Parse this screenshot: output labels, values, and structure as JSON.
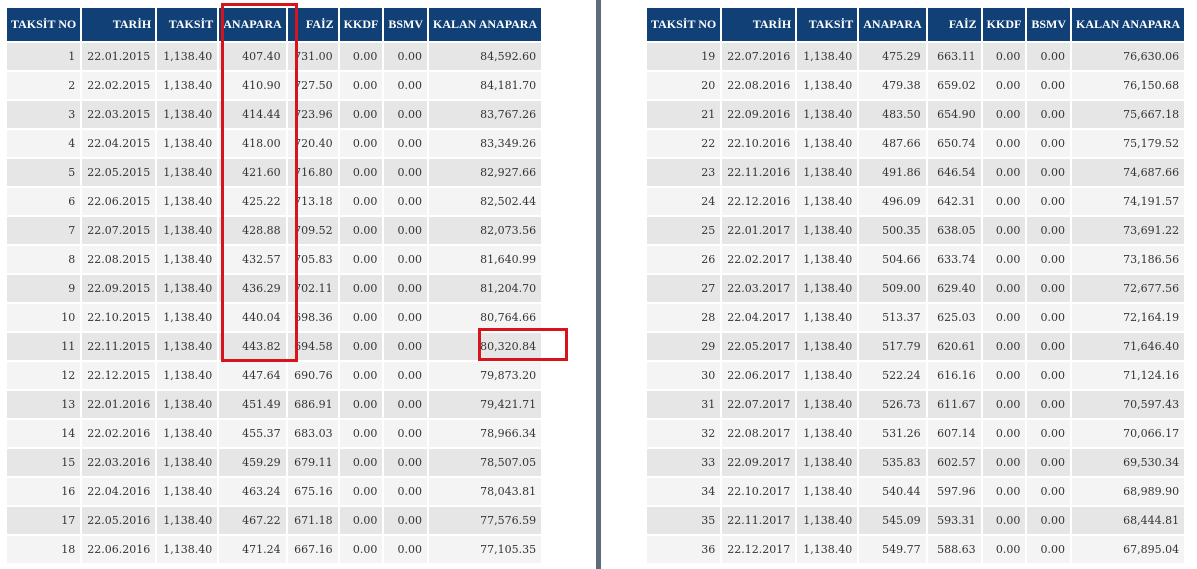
{
  "headers": [
    "TAKSİT NO",
    "TARİH",
    "TAKSİT",
    "ANAPARA",
    "FAİZ",
    "KKDF",
    "BSMV",
    "KALAN ANAPARA"
  ],
  "left_rows": [
    [
      "1",
      "22.01.2015",
      "1,138.40",
      "407.40",
      "731.00",
      "0.00",
      "0.00",
      "84,592.60"
    ],
    [
      "2",
      "22.02.2015",
      "1,138.40",
      "410.90",
      "727.50",
      "0.00",
      "0.00",
      "84,181.70"
    ],
    [
      "3",
      "22.03.2015",
      "1,138.40",
      "414.44",
      "723.96",
      "0.00",
      "0.00",
      "83,767.26"
    ],
    [
      "4",
      "22.04.2015",
      "1,138.40",
      "418.00",
      "720.40",
      "0.00",
      "0.00",
      "83,349.26"
    ],
    [
      "5",
      "22.05.2015",
      "1,138.40",
      "421.60",
      "716.80",
      "0.00",
      "0.00",
      "82,927.66"
    ],
    [
      "6",
      "22.06.2015",
      "1,138.40",
      "425.22",
      "713.18",
      "0.00",
      "0.00",
      "82,502.44"
    ],
    [
      "7",
      "22.07.2015",
      "1,138.40",
      "428.88",
      "709.52",
      "0.00",
      "0.00",
      "82,073.56"
    ],
    [
      "8",
      "22.08.2015",
      "1,138.40",
      "432.57",
      "705.83",
      "0.00",
      "0.00",
      "81,640.99"
    ],
    [
      "9",
      "22.09.2015",
      "1,138.40",
      "436.29",
      "702.11",
      "0.00",
      "0.00",
      "81,204.70"
    ],
    [
      "10",
      "22.10.2015",
      "1,138.40",
      "440.04",
      "698.36",
      "0.00",
      "0.00",
      "80,764.66"
    ],
    [
      "11",
      "22.11.2015",
      "1,138.40",
      "443.82",
      "694.58",
      "0.00",
      "0.00",
      "80,320.84"
    ],
    [
      "12",
      "22.12.2015",
      "1,138.40",
      "447.64",
      "690.76",
      "0.00",
      "0.00",
      "79,873.20"
    ],
    [
      "13",
      "22.01.2016",
      "1,138.40",
      "451.49",
      "686.91",
      "0.00",
      "0.00",
      "79,421.71"
    ],
    [
      "14",
      "22.02.2016",
      "1,138.40",
      "455.37",
      "683.03",
      "0.00",
      "0.00",
      "78,966.34"
    ],
    [
      "15",
      "22.03.2016",
      "1,138.40",
      "459.29",
      "679.11",
      "0.00",
      "0.00",
      "78,507.05"
    ],
    [
      "16",
      "22.04.2016",
      "1,138.40",
      "463.24",
      "675.16",
      "0.00",
      "0.00",
      "78,043.81"
    ],
    [
      "17",
      "22.05.2016",
      "1,138.40",
      "467.22",
      "671.18",
      "0.00",
      "0.00",
      "77,576.59"
    ],
    [
      "18",
      "22.06.2016",
      "1,138.40",
      "471.24",
      "667.16",
      "0.00",
      "0.00",
      "77,105.35"
    ]
  ],
  "right_rows": [
    [
      "19",
      "22.07.2016",
      "1,138.40",
      "475.29",
      "663.11",
      "0.00",
      "0.00",
      "76,630.06"
    ],
    [
      "20",
      "22.08.2016",
      "1,138.40",
      "479.38",
      "659.02",
      "0.00",
      "0.00",
      "76,150.68"
    ],
    [
      "21",
      "22.09.2016",
      "1,138.40",
      "483.50",
      "654.90",
      "0.00",
      "0.00",
      "75,667.18"
    ],
    [
      "22",
      "22.10.2016",
      "1,138.40",
      "487.66",
      "650.74",
      "0.00",
      "0.00",
      "75,179.52"
    ],
    [
      "23",
      "22.11.2016",
      "1,138.40",
      "491.86",
      "646.54",
      "0.00",
      "0.00",
      "74,687.66"
    ],
    [
      "24",
      "22.12.2016",
      "1,138.40",
      "496.09",
      "642.31",
      "0.00",
      "0.00",
      "74,191.57"
    ],
    [
      "25",
      "22.01.2017",
      "1,138.40",
      "500.35",
      "638.05",
      "0.00",
      "0.00",
      "73,691.22"
    ],
    [
      "26",
      "22.02.2017",
      "1,138.40",
      "504.66",
      "633.74",
      "0.00",
      "0.00",
      "73,186.56"
    ],
    [
      "27",
      "22.03.2017",
      "1,138.40",
      "509.00",
      "629.40",
      "0.00",
      "0.00",
      "72,677.56"
    ],
    [
      "28",
      "22.04.2017",
      "1,138.40",
      "513.37",
      "625.03",
      "0.00",
      "0.00",
      "72,164.19"
    ],
    [
      "29",
      "22.05.2017",
      "1,138.40",
      "517.79",
      "620.61",
      "0.00",
      "0.00",
      "71,646.40"
    ],
    [
      "30",
      "22.06.2017",
      "1,138.40",
      "522.24",
      "616.16",
      "0.00",
      "0.00",
      "71,124.16"
    ],
    [
      "31",
      "22.07.2017",
      "1,138.40",
      "526.73",
      "611.67",
      "0.00",
      "0.00",
      "70,597.43"
    ],
    [
      "32",
      "22.08.2017",
      "1,138.40",
      "531.26",
      "607.14",
      "0.00",
      "0.00",
      "70,066.17"
    ],
    [
      "33",
      "22.09.2017",
      "1,138.40",
      "535.83",
      "602.57",
      "0.00",
      "0.00",
      "69,530.34"
    ],
    [
      "34",
      "22.10.2017",
      "1,138.40",
      "540.44",
      "597.96",
      "0.00",
      "0.00",
      "68,989.90"
    ],
    [
      "35",
      "22.11.2017",
      "1,138.40",
      "545.09",
      "593.31",
      "0.00",
      "0.00",
      "68,444.81"
    ],
    [
      "36",
      "22.12.2017",
      "1,138.40",
      "549.77",
      "588.63",
      "0.00",
      "0.00",
      "67,895.04"
    ]
  ],
  "colors": {
    "header_bg": "#114077",
    "row_odd": "#e6e6e6",
    "row_even": "#f4f4f4",
    "highlight": "#d7141e",
    "divider": "#5f6b7a"
  }
}
